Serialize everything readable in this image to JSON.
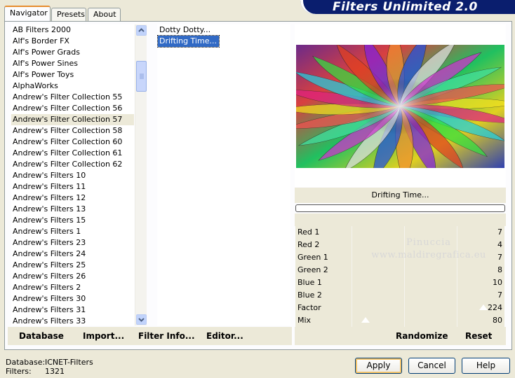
{
  "tabs": [
    "Navigator",
    "Presets",
    "About"
  ],
  "app_title": "Filters Unlimited 2.0",
  "categories": [
    "AB Filters 2000",
    "Alf's Border FX",
    "Alf's Power Grads",
    "Alf's Power Sines",
    "Alf's Power Toys",
    "AlphaWorks",
    "Andrew's Filter Collection 55",
    "Andrew's Filter Collection 56",
    "Andrew's Filter Collection 57",
    "Andrew's Filter Collection 58",
    "Andrew's Filter Collection 60",
    "Andrew's Filter Collection 61",
    "Andrew's Filter Collection 62",
    "Andrew's Filters 10",
    "Andrew's Filters 11",
    "Andrew's Filters 12",
    "Andrew's Filters 13",
    "Andrew's Filters 15",
    "Andrew's Filters 1",
    "Andrew's Filters 23",
    "Andrew's Filters 24",
    "Andrew's Filters 25",
    "Andrew's Filters 26",
    "Andrew's Filters 2",
    "Andrew's Filters 30",
    "Andrew's Filters 31",
    "Andrew's Filters 33"
  ],
  "selected_category": "Andrew's Filter Collection 57",
  "filters": [
    "Dotty Dotty...",
    "Drifting Time..."
  ],
  "selected_filter": "Drifting Time...",
  "preview_caption": "Drifting Time...",
  "watermark": [
    "Pinuccia",
    "www.maldiregrafica.eu"
  ],
  "params": [
    {
      "label": "Red 1",
      "value": "7"
    },
    {
      "label": "Red 2",
      "value": "4"
    },
    {
      "label": "Green 1",
      "value": "7"
    },
    {
      "label": "Green 2",
      "value": "8"
    },
    {
      "label": "Blue 1",
      "value": "10"
    },
    {
      "label": "Blue 2",
      "value": "7"
    },
    {
      "label": "Factor",
      "value": "224"
    },
    {
      "label": "Mix",
      "value": "80"
    }
  ],
  "left_buttons": [
    "Database",
    "Import...",
    "Filter Info...",
    "Editor..."
  ],
  "right_buttons": [
    "Randomize",
    "Reset"
  ],
  "status": {
    "database_label": "Database:",
    "database_value": "ICNET-Filters",
    "filters_label": "Filters:",
    "filters_value": "1321"
  },
  "dialog_buttons": {
    "apply": "Apply",
    "cancel": "Cancel",
    "help": "Help"
  }
}
